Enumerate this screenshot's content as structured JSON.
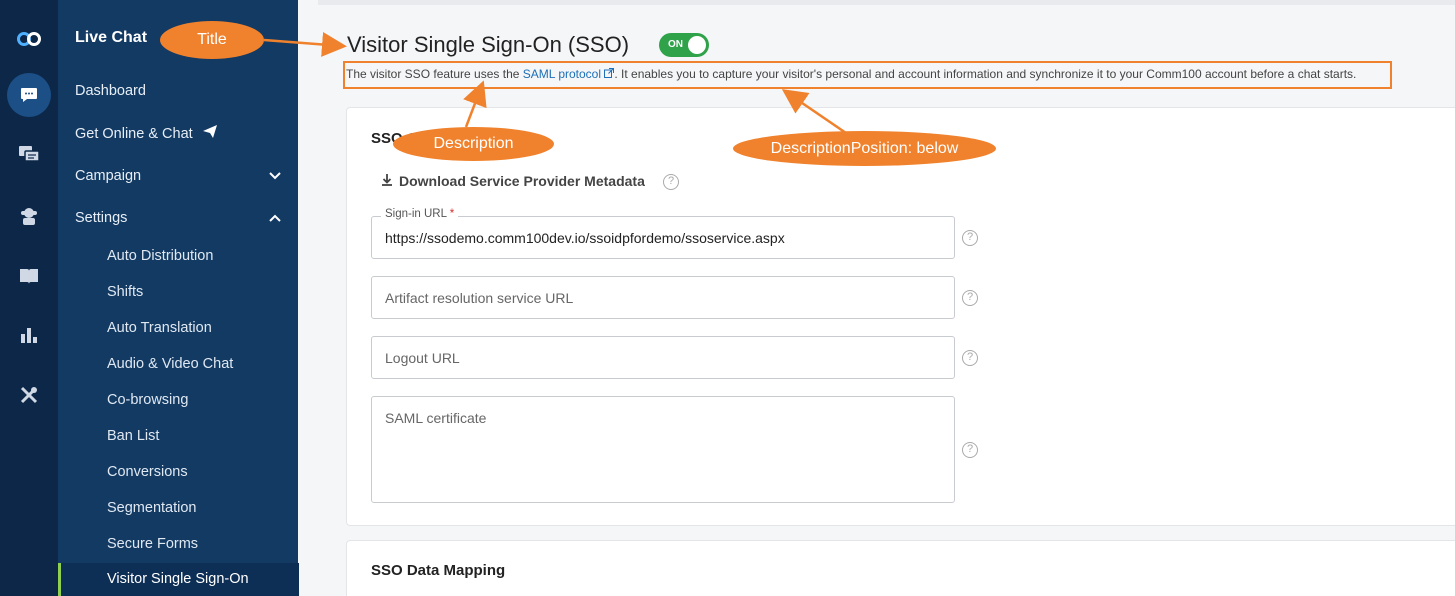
{
  "nav": {
    "title": "Live Chat",
    "items": [
      {
        "label": "Dashboard"
      },
      {
        "label": "Get Online & Chat"
      },
      {
        "label": "Campaign"
      },
      {
        "label": "Settings"
      }
    ],
    "sub_items": [
      {
        "label": "Auto Distribution"
      },
      {
        "label": "Shifts"
      },
      {
        "label": "Auto Translation"
      },
      {
        "label": "Audio & Video Chat"
      },
      {
        "label": "Co-browsing"
      },
      {
        "label": "Ban List"
      },
      {
        "label": "Conversions"
      },
      {
        "label": "Segmentation"
      },
      {
        "label": "Secure Forms"
      },
      {
        "label": "Visitor Single Sign-On"
      }
    ]
  },
  "rail": {
    "icons": [
      "logo-icon",
      "chat-icon",
      "messages-icon",
      "agent-icon",
      "knowledge-book-icon",
      "reports-icon",
      "tools-icon"
    ]
  },
  "header": {
    "title": "Visitor Single Sign-On (SSO)",
    "toggle_label": "ON",
    "desc_before": "The visitor SSO feature uses the ",
    "desc_link": "SAML protocol",
    "desc_after": ". It enables you to capture your visitor's personal and account information and synchronize it to your Comm100 account before a chat starts."
  },
  "card": {
    "title_visible": "SSO C",
    "download_label": "Download Service Provider Metadata",
    "signin_legend": "Sign-in URL",
    "signin_required": "*",
    "signin_value": "https://ssodemo.comm100dev.io/ssoidpfordemo/ssoservice.aspx",
    "artifact_placeholder": "Artifact resolution service URL",
    "logout_placeholder": "Logout URL",
    "saml_placeholder": "SAML certificate"
  },
  "card2": {
    "title": "SSO Data Mapping"
  },
  "annotations": {
    "title": "Title",
    "description": "Description",
    "description_position": "DescriptionPosition: below"
  },
  "colors": {
    "rail": "#0c2748",
    "nav": "#123a63",
    "toggle": "#2fa24a",
    "annotation": "#f0822d",
    "link": "#1d6fb8",
    "active_marker": "#8fd14f"
  }
}
